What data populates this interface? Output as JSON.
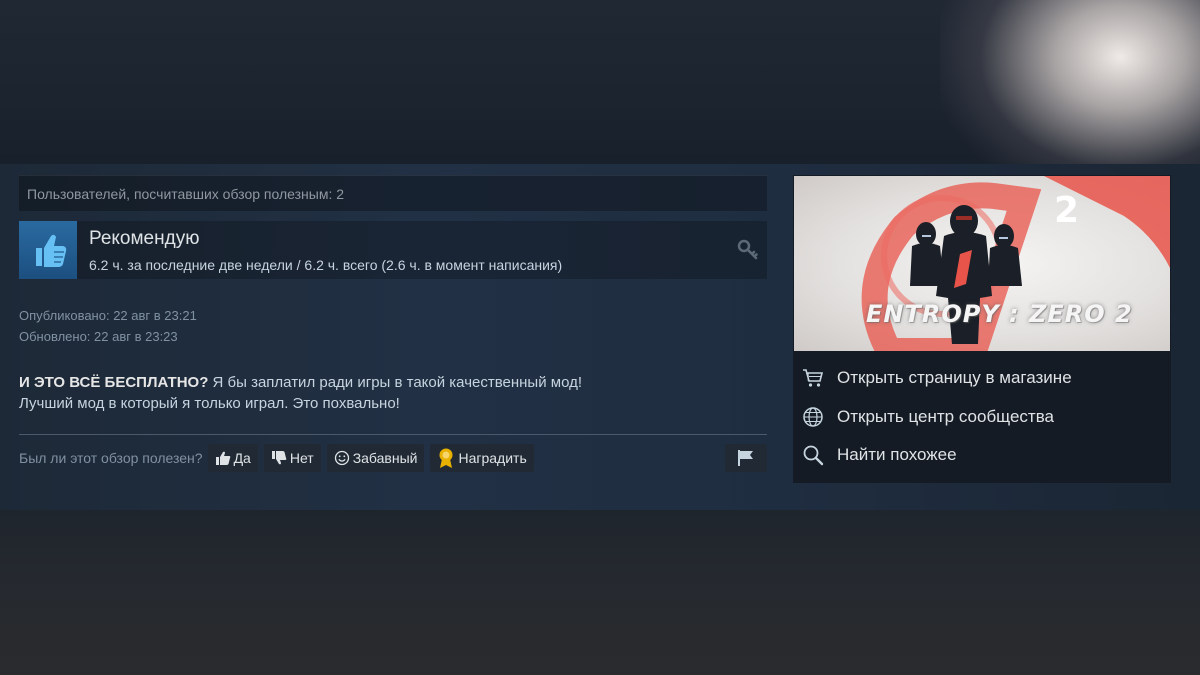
{
  "review": {
    "helpful_count_text": "Пользователей, посчитавших обзор полезным: 2",
    "recommendation": "Рекомендую",
    "hours_text": "6.2 ч. за последние две недели / 6.2 ч. всего (2.6 ч. в момент написания)",
    "published": "Опубликовано: 22 авг в 23:21",
    "updated": "Обновлено: 22 авг в 23:23",
    "body": {
      "line1_bold": "И ЭТО ВСЁ БЕСПЛАТНО?",
      "line1_rest": " Я бы заплатил ради игры в такой качественный мод!",
      "line2": "Лучший мод в который я только играл. Это похвально!"
    },
    "icons": {
      "thumb": "thumbs-up-icon",
      "key": "key-icon"
    }
  },
  "vote": {
    "question": "Был ли этот обзор полезен?",
    "yes": "Да",
    "no": "Нет",
    "funny": "Забавный",
    "award": "Наградить",
    "award_color": "#e8b100"
  },
  "sidebar": {
    "game_title": "ENTROPY : ZERO 2",
    "capsule_number": "2",
    "links": [
      {
        "label": "Открыть страницу в магазине",
        "icon": "cart-icon"
      },
      {
        "label": "Открыть центр сообщества",
        "icon": "globe-icon"
      },
      {
        "label": "Найти похожее",
        "icon": "magnifier-icon"
      }
    ],
    "accent_color": "#e8544a"
  }
}
